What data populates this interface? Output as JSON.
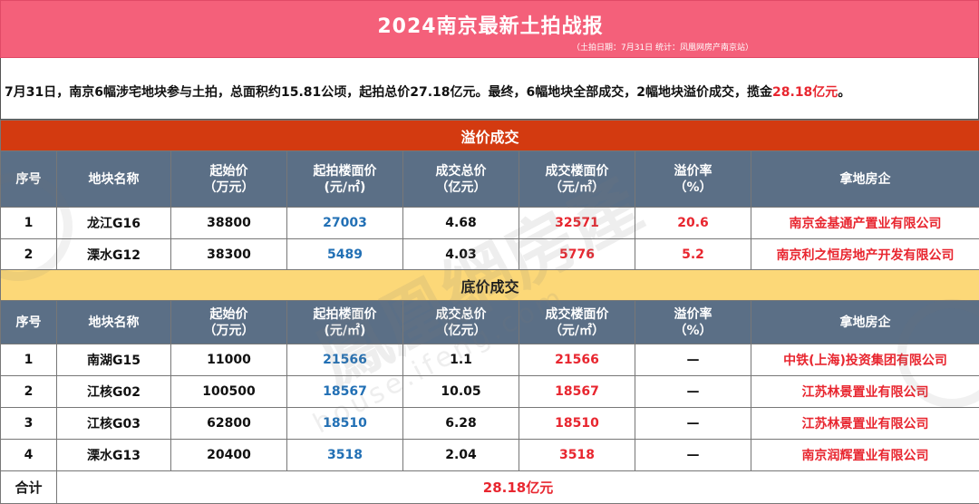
{
  "header": {
    "title": "2024南京最新土拍战报",
    "subtitle": "（土拍日期：7月31日   统计：凤凰网房产南京站）"
  },
  "summary": {
    "text": "7月31日，南京6幅涉宅地块参与土拍，总面积约15.81公顷，起拍总价27.18亿元。最终，6幅地块全部成交，2幅地块溢价成交，揽金",
    "highlight": "28.18亿元",
    "end": "。"
  },
  "columns": {
    "seq": "序号",
    "name": "地块名称",
    "start_price": "起始价",
    "start_price_unit": "（万元）",
    "start_floor": "起拍楼面价",
    "start_floor_unit": "(元/㎡)",
    "deal_total": "成交总价",
    "deal_total_unit": "（亿元）",
    "deal_floor": "成交楼面价",
    "deal_floor_unit": "（元/㎡）",
    "premium_rate": "溢价率",
    "premium_rate_unit": "（%）",
    "developer": "拿地房企"
  },
  "premium_section": {
    "title": "溢价成交",
    "rows": [
      {
        "seq": "1",
        "name": "龙江G16",
        "start_price": "38800",
        "start_floor": "27003",
        "deal_total": "4.68",
        "deal_floor": "32571",
        "premium_rate": "20.6",
        "developer": "南京金基通产置业有限公司"
      },
      {
        "seq": "2",
        "name": "溧水G12",
        "start_price": "38300",
        "start_floor": "5489",
        "deal_total": "4.03",
        "deal_floor": "5776",
        "premium_rate": "5.2",
        "developer": "南京利之恒房地产开发有限公司"
      }
    ]
  },
  "floor_section": {
    "title": "底价成交",
    "rows": [
      {
        "seq": "1",
        "name": "南湖G15",
        "start_price": "11000",
        "start_floor": "21566",
        "deal_total": "1.1",
        "deal_floor": "21566",
        "premium_rate": "—",
        "developer": "中铁(上海)投资集团有限公司"
      },
      {
        "seq": "2",
        "name": "江核G02",
        "start_price": "100500",
        "start_floor": "18567",
        "deal_total": "10.05",
        "deal_floor": "18567",
        "premium_rate": "—",
        "developer": "江苏林景置业有限公司"
      },
      {
        "seq": "3",
        "name": "江核G03",
        "start_price": "62800",
        "start_floor": "18510",
        "deal_total": "6.28",
        "deal_floor": "18510",
        "premium_rate": "—",
        "developer": "江苏林景置业有限公司"
      },
      {
        "seq": "4",
        "name": "溧水G13",
        "start_price": "20400",
        "start_floor": "3518",
        "deal_total": "2.04",
        "deal_floor": "3518",
        "premium_rate": "—",
        "developer": "南京润辉置业有限公司"
      }
    ]
  },
  "total": {
    "label": "合计",
    "value": "28.18亿元"
  },
  "watermark": {
    "brand": "鳳凰網房產",
    "domain": "house.ifeng.com"
  },
  "colors": {
    "title_bg": "#f4607a",
    "premium_bar": "#d33a10",
    "floor_bar": "#fcd878",
    "header_bg": "#5b6f86",
    "red": "#e8262f",
    "blue": "#2270b5"
  }
}
